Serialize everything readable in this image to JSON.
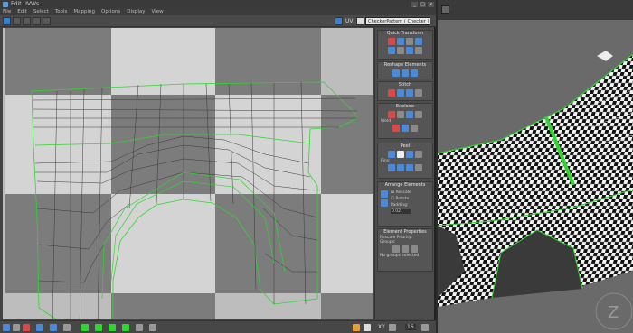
{
  "window": {
    "title": "Edit UVWs",
    "controls": [
      "_",
      "□",
      "×"
    ]
  },
  "menu": [
    "File",
    "Edit",
    "Select",
    "Tools",
    "Mapping",
    "Options",
    "Display",
    "View"
  ],
  "toolbar": {
    "uv_label": "UV",
    "texture_combo": "CheckerPattern  ( Checker )"
  },
  "panel": {
    "quick_transform": "Quick Transform",
    "reshape": "Reshape Elements",
    "stitch": "Stitch",
    "explode": "Explode",
    "weld": "Weld",
    "peel": "Peel",
    "pins": "Pins:",
    "arrange": "Arrange Elements",
    "rescale": "Rescale",
    "rotate": "Rotate",
    "padding_label": "Padding:",
    "padding_value": "0.02",
    "element_props": "Element Properties",
    "rescale_priority": "Rescale Priority:",
    "groups": "Groups:",
    "groups_selected": "No groups selected"
  },
  "status": {
    "xy": "XY",
    "grid_value": "16"
  },
  "colors": {
    "accent_blue": "#4a8ad8",
    "seam_green": "#2fd62f",
    "checker_dark": "#7c7c7c",
    "checker_light": "#d4d4d4"
  }
}
